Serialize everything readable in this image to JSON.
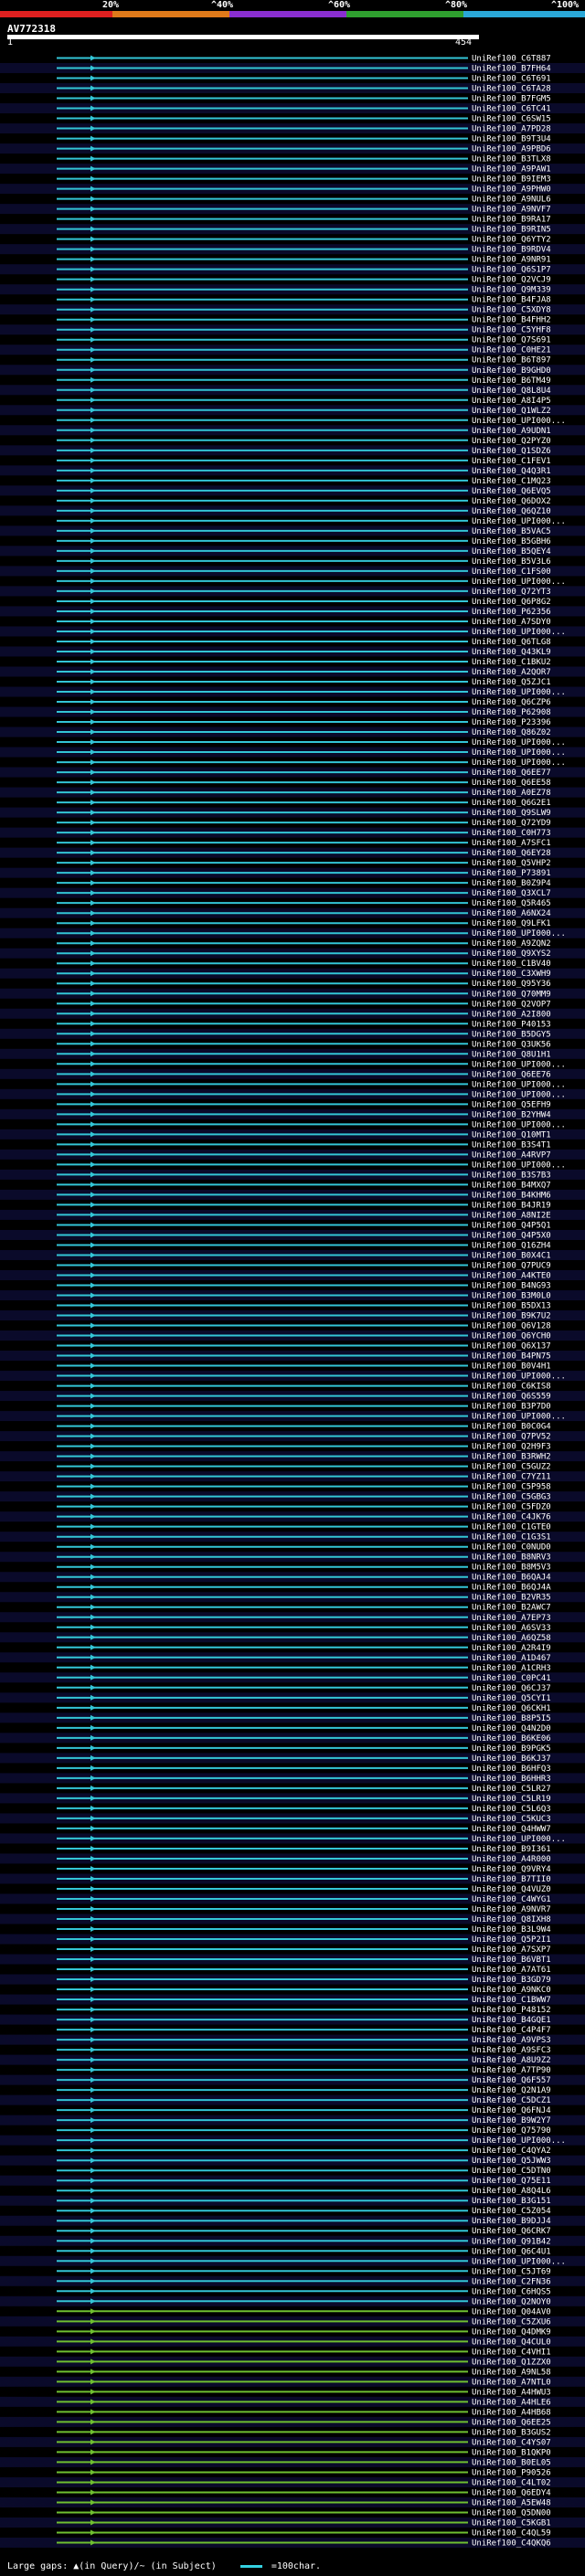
{
  "header": {
    "percent_labels": [
      "20%",
      "^40%",
      "^60%",
      "^80%",
      "^100%"
    ],
    "segment_colors": [
      "#e02020",
      "#e07a1a",
      "#8a2ed0",
      "#2fa02f",
      "#2aa8d8"
    ]
  },
  "chart_data": {
    "type": "alignment",
    "query": "AV772318",
    "query_length": 454,
    "start_label": "1",
    "end_label": "454",
    "colors": {
      "hit": "#33c5d6",
      "hit_alt": "#6fbf30",
      "background_band": "#0a0a2a"
    },
    "hit_ids": [
      "UniRef100_C6T887",
      "UniRef100_B7FH64",
      "UniRef100_C6T691",
      "UniRef100_C6TA28",
      "UniRef100_B7FGM5",
      "UniRef100_C6TC41",
      "UniRef100_C6SW15",
      "UniRef100_A7PD28",
      "UniRef100_B9T3U4",
      "UniRef100_A9PBD6",
      "UniRef100_B3TLX8",
      "UniRef100_A9PAW1",
      "UniRef100_B9IEM3",
      "UniRef100_A9PHW0",
      "UniRef100_A9NUL6",
      "UniRef100_A9NVF7",
      "UniRef100_B9RA17",
      "UniRef100_B9RIN5",
      "UniRef100_Q6YTY2",
      "UniRef100_B9RDV4",
      "UniRef100_A9NR91",
      "UniRef100_Q6S1P7",
      "UniRef100_Q2VCJ9",
      "UniRef100_Q9M339",
      "UniRef100_B4FJA8",
      "UniRef100_C5XDY8",
      "UniRef100_B4FHH2",
      "UniRef100_C5YHF8",
      "UniRef100_Q7S691",
      "UniRef100_C0HE21",
      "UniRef100_B6T897",
      "UniRef100_B9GHD0",
      "UniRef100_B6TM49",
      "UniRef100_Q8L8U4",
      "UniRef100_A8I4P5",
      "UniRef100_Q1WLZ2",
      "UniRef100_UPI000...",
      "UniRef100_A9UDN1",
      "UniRef100_Q2PYZ0",
      "UniRef100_Q1SDZ6",
      "UniRef100_C1FEV1",
      "UniRef100_Q4Q3R1",
      "UniRef100_C1MQ23",
      "UniRef100_Q6EVQ5",
      "UniRef100_Q6DOX2",
      "UniRef100_Q6QZ10",
      "UniRef100_UPI000...",
      "UniRef100_B5VAC5",
      "UniRef100_B5GBH6",
      "UniRef100_B5QEY4",
      "UniRef100_B5V3L6",
      "UniRef100_C1FS00",
      "UniRef100_UPI000...",
      "UniRef100_Q72YT3",
      "UniRef100_Q6P8G2",
      "UniRef100_P62356",
      "UniRef100_A7SDY0",
      "UniRef100_UPI000...",
      "UniRef100_Q6TLG8",
      "UniRef100_Q43KL9",
      "UniRef100_C1BKU2",
      "UniRef100_A2QOR7",
      "UniRef100_Q5ZJC1",
      "UniRef100_UPI000...",
      "UniRef100_Q6CZP6",
      "UniRef100_P62908",
      "UniRef100_P23396",
      "UniRef100_Q86Z02",
      "UniRef100_UPI000...",
      "UniRef100_UPI000...",
      "UniRef100_UPI000...",
      "UniRef100_Q6EE77",
      "UniRef100_Q6EE58",
      "UniRef100_A0EZ78",
      "UniRef100_Q6G2E1",
      "UniRef100_Q9SLW9",
      "UniRef100_Q72YD9",
      "UniRef100_C0H773",
      "UniRef100_A7SFC1",
      "UniRef100_Q6EY28",
      "UniRef100_Q5VHP2",
      "UniRef100_P73891",
      "UniRef100_B0Z9P4",
      "UniRef100_Q3XCL7",
      "UniRef100_Q5R465",
      "UniRef100_A6NX24",
      "UniRef100_Q9LFK1",
      "UniRef100_UPI000...",
      "UniRef100_A9ZQN2",
      "UniRef100_Q9XYS2",
      "UniRef100_C1BV40",
      "UniRef100_C3XWH9",
      "UniRef100_Q95Y36",
      "UniRef100_Q70MM9",
      "UniRef100_Q2VOP7",
      "UniRef100_A2I800",
      "UniRef100_P40153",
      "UniRef100_B5DGY5",
      "UniRef100_Q3UK56",
      "UniRef100_Q8U1H1",
      "UniRef100_UPI000...",
      "UniRef100_Q6EE76",
      "UniRef100_UPI000...",
      "UniRef100_UPI000...",
      "UniRef100_Q5EFH9",
      "UniRef100_B2YHW4",
      "UniRef100_UPI000...",
      "UniRef100_Q10MT1",
      "UniRef100_B3S4T1",
      "UniRef100_A4RVP7",
      "UniRef100_UPI000...",
      "UniRef100_B3S7B3",
      "UniRef100_B4MXQ7",
      "UniRef100_B4KHM6",
      "UniRef100_B4JR19",
      "UniRef100_A8NI2E",
      "UniRef100_Q4P5Q1",
      "UniRef100_Q4P5X0",
      "UniRef100_Q16ZH4",
      "UniRef100_B0X4C1",
      "UniRef100_Q7PUC9",
      "UniRef100_A4KTE0",
      "UniRef100_B4NG93",
      "UniRef100_B3M0L0",
      "UniRef100_B5DX13",
      "UniRef100_B9K7U2",
      "UniRef100_Q6V128",
      "UniRef100_Q6YCH0",
      "UniRef100_Q6X137",
      "UniRef100_B4PN75",
      "UniRef100_B0V4H1",
      "UniRef100_UPI000...",
      "UniRef100_C6KIS8",
      "UniRef100_Q6S559",
      "UniRef100_B3P7D0",
      "UniRef100_UPI000...",
      "UniRef100_B0C0G4",
      "UniRef100_Q7PV52",
      "UniRef100_Q2H9F3",
      "UniRef100_B3RWH2",
      "UniRef100_C5GUZ2",
      "UniRef100_C7YZ11",
      "UniRef100_C5P958",
      "UniRef100_C5GBG3",
      "UniRef100_C5FDZ0",
      "UniRef100_C4JK76",
      "UniRef100_C1GTE0",
      "UniRef100_C1G3S1",
      "UniRef100_C0NUD0",
      "UniRef100_B8NRV3",
      "UniRef100_B8M5V3",
      "UniRef100_B6QAJ4",
      "UniRef100_B6QJ4A",
      "UniRef100_B2VR35",
      "UniRef100_B2AWC7",
      "UniRef100_A7EP73",
      "UniRef100_A6SV33",
      "UniRef100_A6QZ58",
      "UniRef100_A2R4I9",
      "UniRef100_A1D467",
      "UniRef100_A1CRH3",
      "UniRef100_C0PC41",
      "UniRef100_Q6CJ37",
      "UniRef100_Q5CYI1",
      "UniRef100_Q6CKH1",
      "UniRef100_B8P5I5",
      "UniRef100_Q4N2D0",
      "UniRef100_B6KE06",
      "UniRef100_B9PGK5",
      "UniRef100_B6KJ37",
      "UniRef100_B6HFQ3",
      "UniRef100_B6HHR3",
      "UniRef100_C5LR27",
      "UniRef100_C5LR19",
      "UniRef100_C5L6Q3",
      "UniRef100_C5KUC3",
      "UniRef100_Q4HWW7",
      "UniRef100_UPI000...",
      "UniRef100_B9I361",
      "UniRef100_A4R000",
      "UniRef100_Q9VRY4",
      "UniRef100_B7TII0",
      "UniRef100_Q4VUZ0",
      "UniRef100_C4WYG1",
      "UniRef100_A9NVR7",
      "UniRef100_Q8IXH8",
      "UniRef100_B3L9W4",
      "UniRef100_Q5P2I1",
      "UniRef100_A7SXP7",
      "UniRef100_B6VBT1",
      "UniRef100_A7AT61",
      "UniRef100_B3GD79",
      "UniRef100_A9NKC0",
      "UniRef100_C1BWW7",
      "UniRef100_P48152",
      "UniRef100_B4GQE1",
      "UniRef100_C4P4F7",
      "UniRef100_A9VPS3",
      "UniRef100_A9SFC3",
      "UniRef100_A8U9Z2",
      "UniRef100_A7TP90",
      "UniRef100_Q6F557",
      "UniRef100_Q2N1A9",
      "UniRef100_C5DCZ1",
      "UniRef100_Q6FNJ4",
      "UniRef100_B9W2Y7",
      "UniRef100_Q75790",
      "UniRef100_UPI000...",
      "UniRef100_C4QYA2",
      "UniRef100_Q5JWW3",
      "UniRef100_C5DTN0",
      "UniRef100_Q75E11",
      "UniRef100_A8Q4L6",
      "UniRef100_B3G151",
      "UniRef100_C5Z054",
      "UniRef100_B9DJJ4",
      "UniRef100_Q6CRK7",
      "UniRef100_Q91B42",
      "UniRef100_Q6C4U1",
      "UniRef100_UPI000...",
      "UniRef100_C5JT69",
      "UniRef100_C2FN36",
      "UniRef100_C6HQS5",
      "UniRef100_Q2NOY0",
      "UniRef100_Q04AV0",
      "UniRef100_C5ZXU6",
      "UniRef100_Q4DMK9",
      "UniRef100_Q4CUL0",
      "UniRef100_C4VHI1",
      "UniRef100_Q1ZZX0",
      "UniRef100_A9NL58",
      "UniRef100_A7NTL0",
      "UniRef100_A4HWU3",
      "UniRef100_A4HLE6",
      "UniRef100_A4HB68",
      "UniRef100_Q6EE25",
      "UniRef100_B3GUS2",
      "UniRef100_C4YS07",
      "UniRef100_B1QKP0",
      "UniRef100_B0EL05",
      "UniRef100_P90526",
      "UniRef100_C4LT02",
      "UniRef100_Q6EDY4",
      "UniRef100_A5EW48",
      "UniRef100_Q5DN00",
      "UniRef100_C5KGB1",
      "UniRef100_C4QL59",
      "UniRef100_C4QKQ6"
    ]
  },
  "footer": {
    "gaps_text": "Large gaps: ▲(in Query)/~ (in Subject)",
    "scale_text": "=100char."
  }
}
